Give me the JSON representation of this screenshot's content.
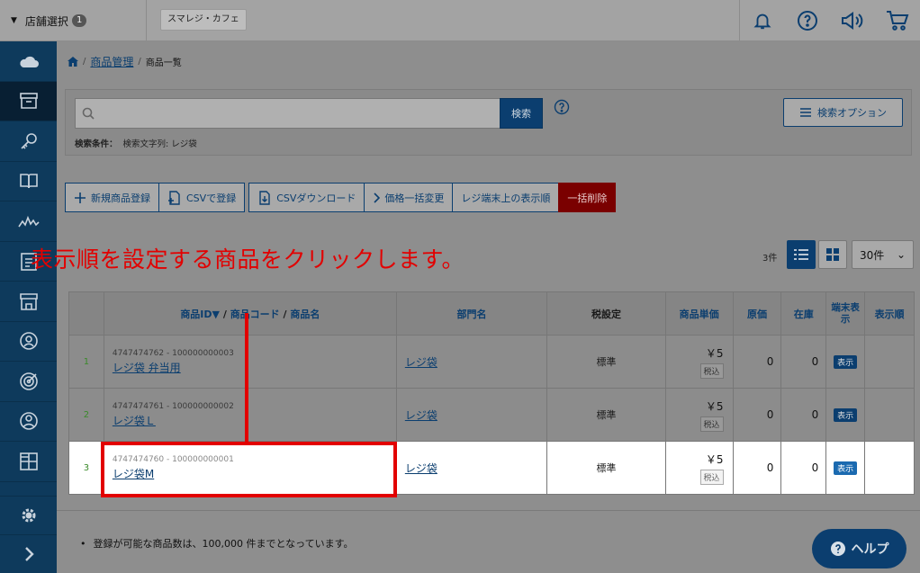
{
  "topbar": {
    "store_select_label": "店舗選択",
    "store_count": "1",
    "store_chip": "スマレジ・カフェ",
    "icons": [
      "bell-icon",
      "help-circle-icon",
      "megaphone-icon",
      "cart-icon"
    ]
  },
  "sidebar": {
    "items": [
      "cloud-icon",
      "box-icon",
      "key-icon",
      "book-icon",
      "chart-line-icon",
      "clipboard-icon",
      "store-icon",
      "person-circle-icon",
      "target-icon",
      "user-circle-icon",
      "grid-icon"
    ],
    "bottom": [
      "gear-icon",
      "chevron-right-icon"
    ]
  },
  "breadcrumb": {
    "home": "home-icon",
    "level1": "商品管理",
    "sep": "/",
    "level2": "商品一覧"
  },
  "search": {
    "placeholder": "",
    "button": "検索",
    "options_button": "検索オプション",
    "condition_label": "検索条件：",
    "condition_value": "検索文字列: レジ袋"
  },
  "toolbar": {
    "new_product": "新規商品登録",
    "csv_register": "CSVで登録",
    "csv_download": "CSVダウンロード",
    "price_bulk": "価格一括変更",
    "display_order": "レジ端末上の表示順",
    "bulk_delete": "一括削除"
  },
  "annotation": {
    "callout": "表示順を設定する商品をクリックします。"
  },
  "list": {
    "count": "3件",
    "per_page": "30件",
    "per_page_arrow": "⌄"
  },
  "table": {
    "headers": {
      "id_part1": "商品ID▼",
      "slash1": " / ",
      "id_part2": "商品コード",
      "slash2": " / ",
      "id_part3": "商品名",
      "dept": "部門名",
      "tax": "税設定",
      "price": "商品単価",
      "cost": "原価",
      "stock": "在庫",
      "terminal": "端末表示",
      "order": "表示順"
    },
    "rows": [
      {
        "num": "1",
        "code": "4747474762 - 100000000003",
        "name": "レジ袋 弁当用",
        "dept": "レジ袋",
        "tax": "標準",
        "price": "￥5",
        "tax_tag": "税込",
        "cost": "0",
        "stock": "0",
        "disp": "表示"
      },
      {
        "num": "2",
        "code": "4747474761 - 100000000002",
        "name": "レジ袋Ｌ",
        "dept": "レジ袋",
        "tax": "標準",
        "price": "￥5",
        "tax_tag": "税込",
        "cost": "0",
        "stock": "0",
        "disp": "表示"
      },
      {
        "num": "3",
        "code": "4747474760 - 100000000001",
        "name": "レジ袋M",
        "dept": "レジ袋",
        "tax": "標準",
        "price": "￥5",
        "tax_tag": "税込",
        "cost": "0",
        "stock": "0",
        "disp": "表示"
      }
    ]
  },
  "footer": {
    "note": "登録が可能な商品数は、100,000 件までとなっています。",
    "help": "ヘルプ"
  }
}
